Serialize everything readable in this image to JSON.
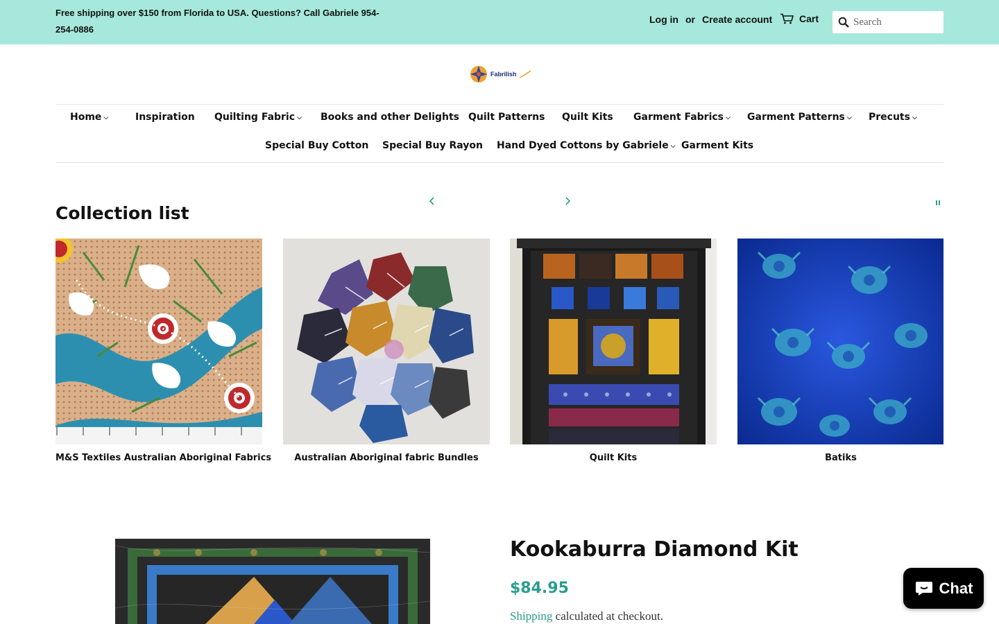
{
  "announcement": {
    "text": "Free shipping over $150 from Florida to USA. Questions? Call Gabriele 954-254-0886"
  },
  "account": {
    "login": "Log in",
    "or": "or",
    "create": "Create account"
  },
  "cart": {
    "label": "Cart"
  },
  "search": {
    "placeholder": "Search"
  },
  "logo": {
    "text": "Fabrilish"
  },
  "nav": {
    "home": "Home",
    "inspiration": "Inspiration",
    "quilting_fabric": "Quilting Fabric",
    "books": "Books and other Delights",
    "quilt_patterns": "Quilt Patterns",
    "quilt_kits": "Quilt Kits",
    "garment_fabrics": "Garment Fabrics",
    "garment_patterns": "Garment Patterns",
    "precuts": "Precuts",
    "special_cotton": "Special Buy Cotton",
    "special_rayon": "Special Buy Rayon",
    "hand_dyed": "Hand Dyed Cottons by Gabriele",
    "garment_kits": "Garment Kits"
  },
  "collections": {
    "title": "Collection list",
    "items": [
      {
        "label": "M&S Textiles Australian Aboriginal Fabrics"
      },
      {
        "label": "Australian Aboriginal fabric Bundles"
      },
      {
        "label": "Quilt Kits"
      },
      {
        "label": "Batiks"
      }
    ]
  },
  "product": {
    "title": "Kookaburra Diamond Kit",
    "price": "$84.95",
    "shipping_link": "Shipping",
    "shipping_rest": " calculated at checkout."
  },
  "chat": {
    "label": "Chat"
  },
  "colors": {
    "topbar_bg": "#a6e8dc",
    "accent": "#2a9d8f",
    "chat_bg": "#000000"
  }
}
